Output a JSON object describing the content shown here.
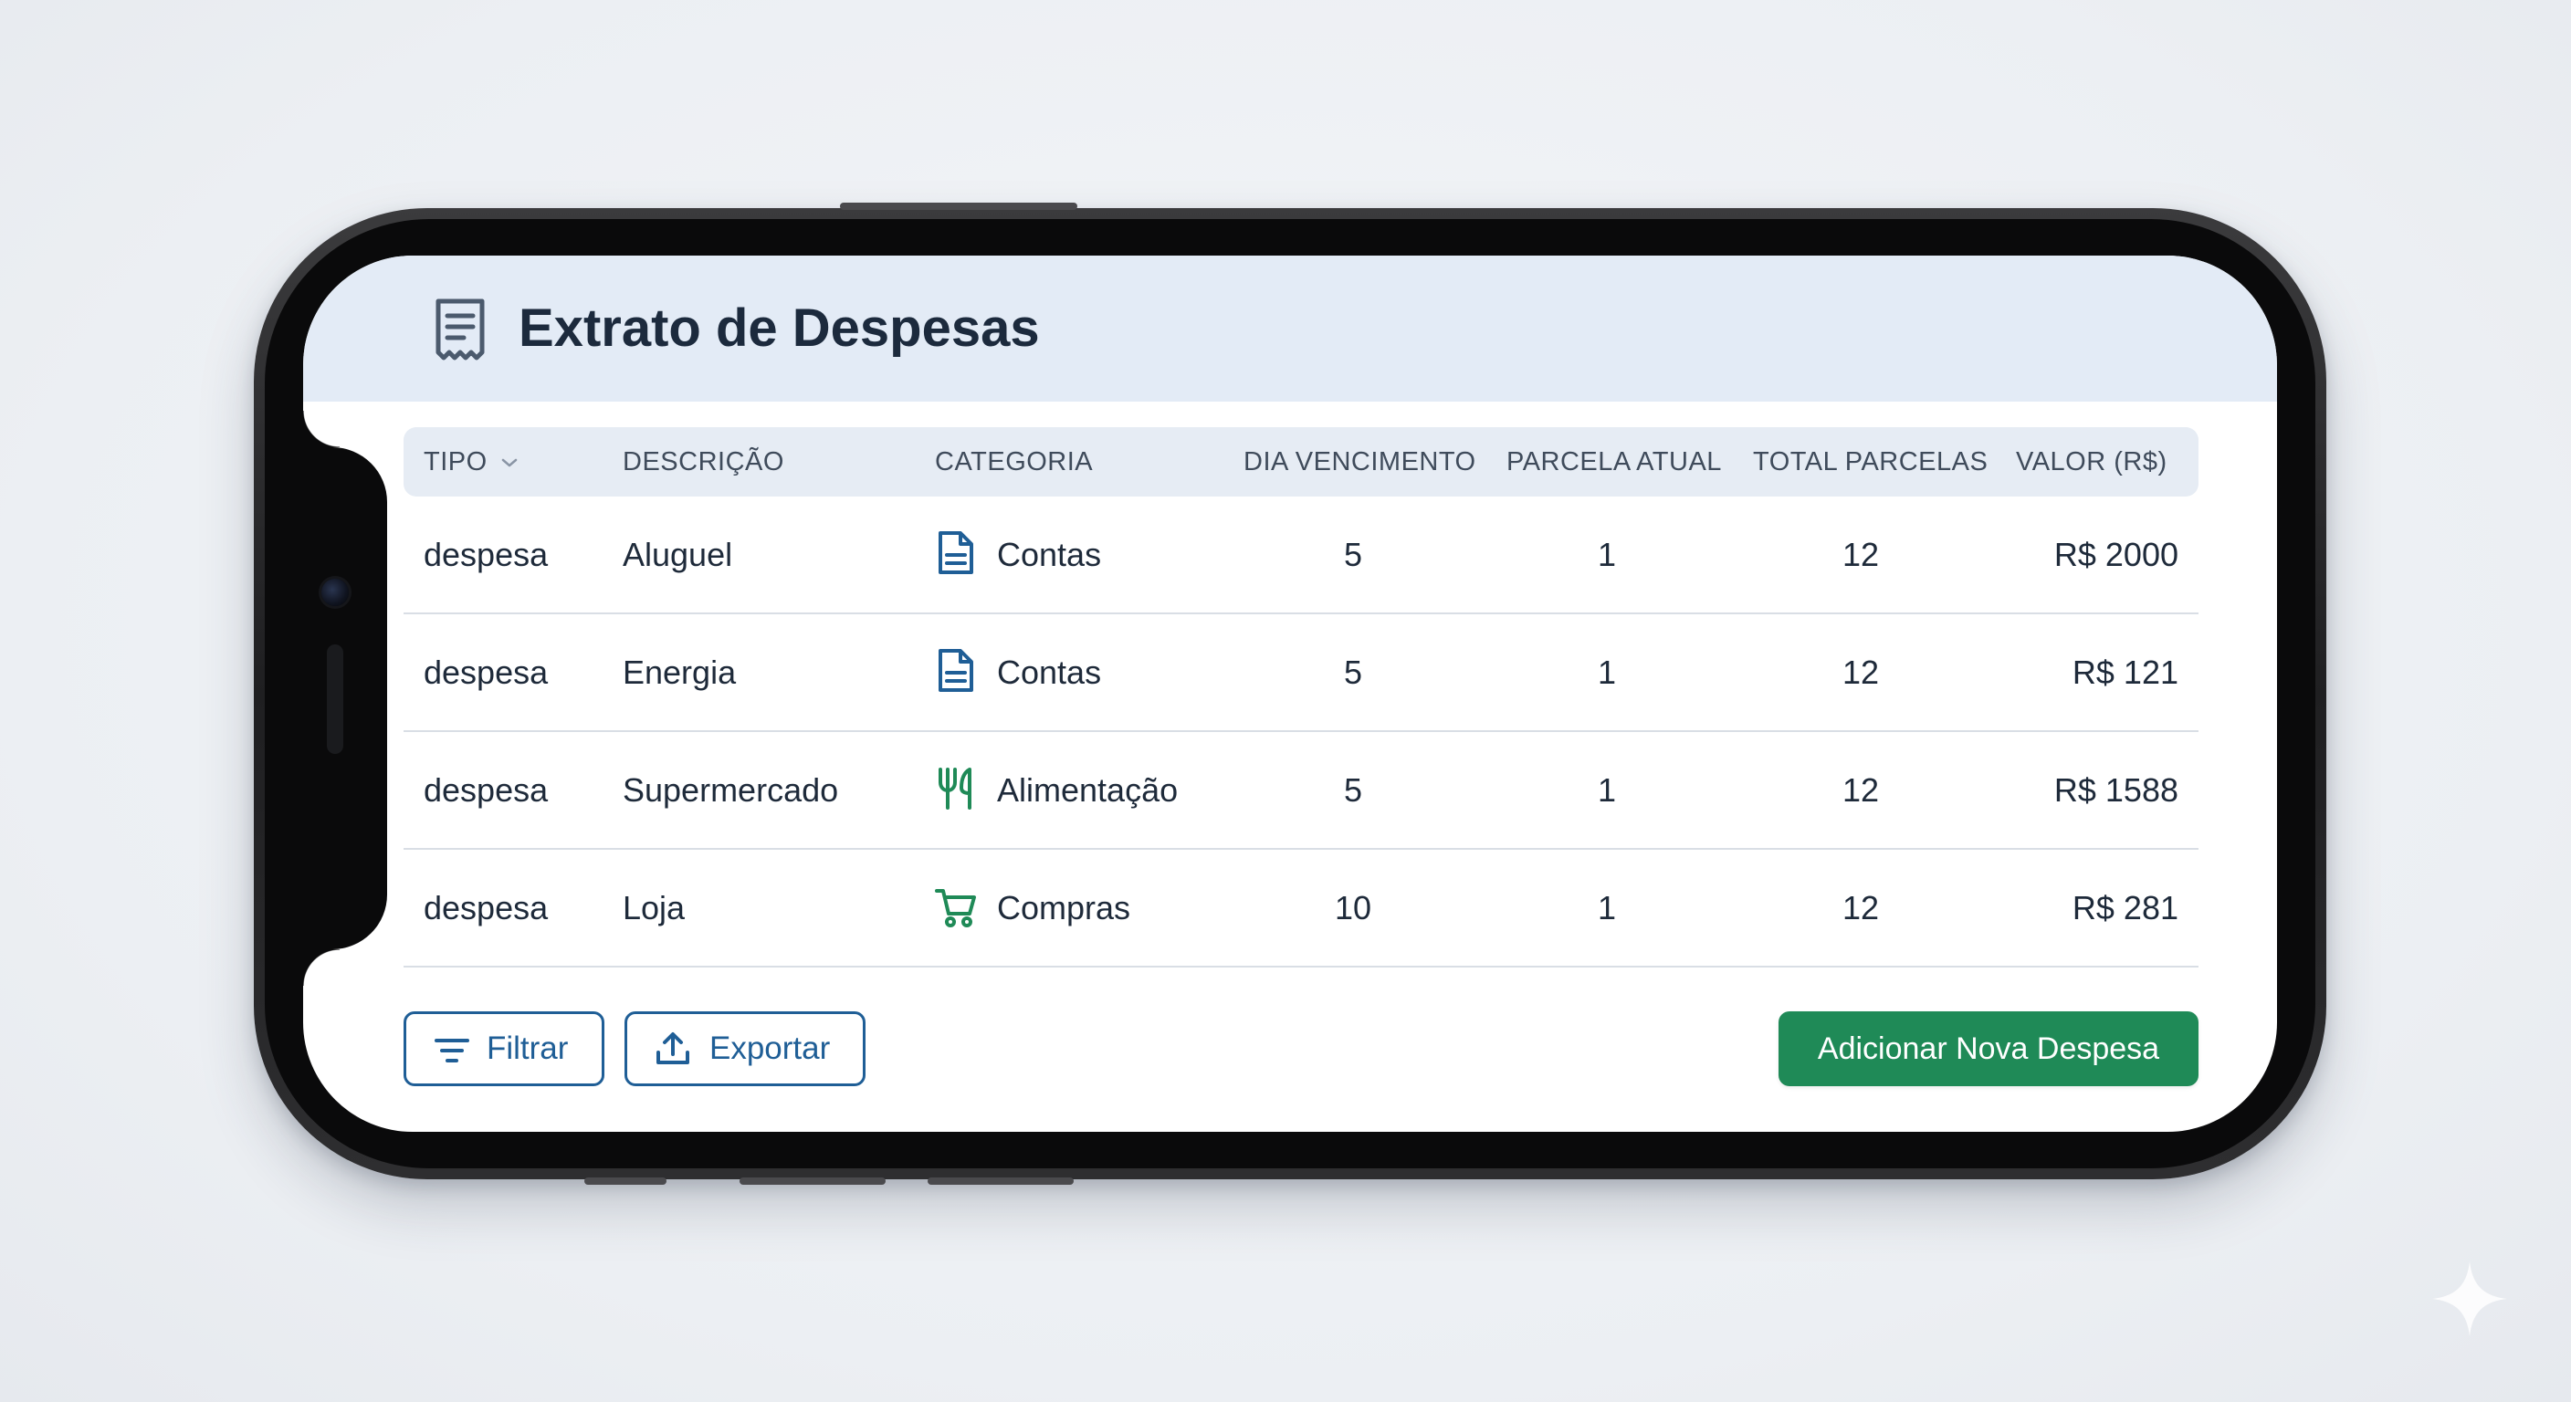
{
  "header": {
    "title": "Extrato de Despesas",
    "icon": "receipt-icon"
  },
  "table": {
    "columns": [
      {
        "key": "tipo",
        "label": "TIPO"
      },
      {
        "key": "descricao",
        "label": "DESCRIÇÃO"
      },
      {
        "key": "categoria",
        "label": "CATEGORIA"
      },
      {
        "key": "dia_vencimento",
        "label": "DIA VENCIMENTO"
      },
      {
        "key": "parcela_atual",
        "label": "PARCELA ATUAL"
      },
      {
        "key": "total_parcelas",
        "label": "TOTAL PARCELAS"
      },
      {
        "key": "valor",
        "label": "VALOR (R$)"
      }
    ],
    "rows": [
      {
        "tipo": "despesa",
        "descricao": "Aluguel",
        "categoria": "Contas",
        "categoria_icon": "document-icon",
        "dia_vencimento": "5",
        "parcela_atual": "1",
        "total_parcelas": "12",
        "valor": "R$ 2000"
      },
      {
        "tipo": "despesa",
        "descricao": "Energia",
        "categoria": "Contas",
        "categoria_icon": "document-icon",
        "dia_vencimento": "5",
        "parcela_atual": "1",
        "total_parcelas": "12",
        "valor": "R$ 121"
      },
      {
        "tipo": "despesa",
        "descricao": "Supermercado",
        "categoria": "Alimentação",
        "categoria_icon": "utensils-icon",
        "dia_vencimento": "5",
        "parcela_atual": "1",
        "total_parcelas": "12",
        "valor": "R$ 1588"
      },
      {
        "tipo": "despesa",
        "descricao": "Loja",
        "categoria": "Compras",
        "categoria_icon": "cart-icon",
        "dia_vencimento": "10",
        "parcela_atual": "1",
        "total_parcelas": "12",
        "valor": "R$ 281"
      }
    ]
  },
  "actions": {
    "filter_label": "Filtrar",
    "export_label": "Exportar",
    "add_label": "Adicionar Nova Despesa"
  },
  "colors": {
    "accent_blue": "#1f5e96",
    "primary_green": "#1f8a57",
    "header_bg": "#e3ebf6"
  }
}
